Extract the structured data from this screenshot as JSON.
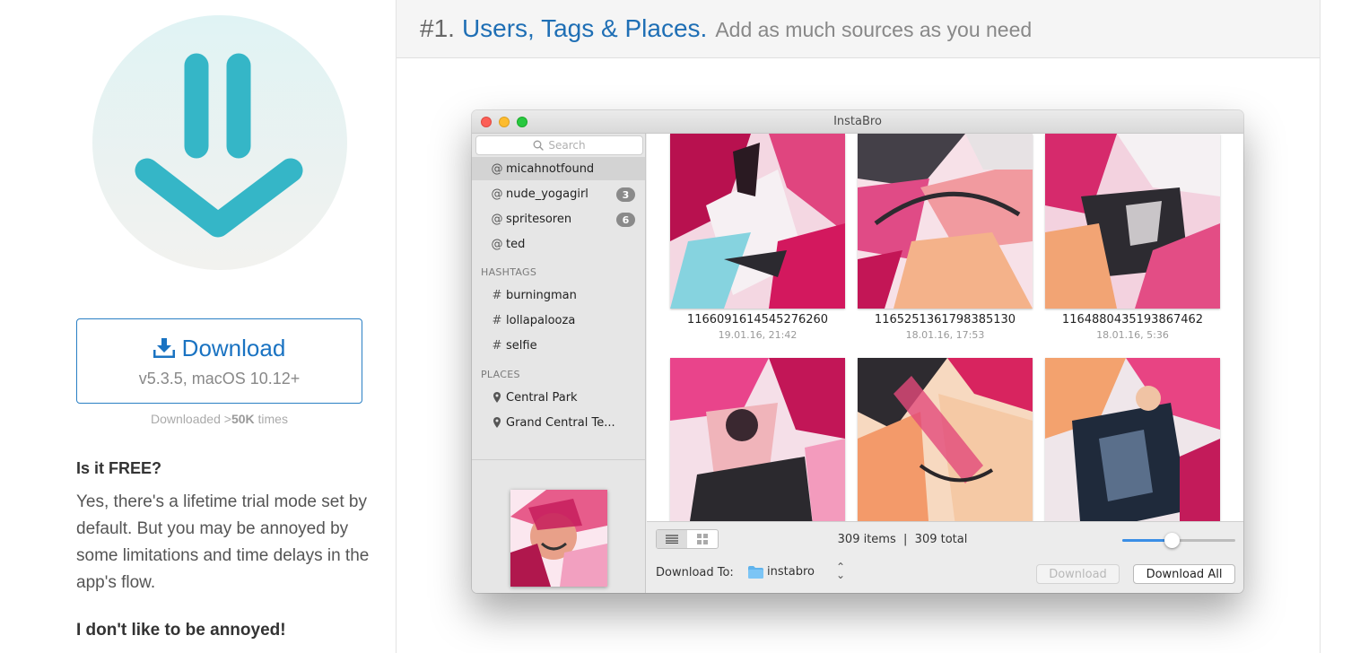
{
  "colors": {
    "brand_blue": "#1a73c2",
    "teal_logo": "#35b6c7",
    "selection_blue": "#3a8ee6"
  },
  "left": {
    "logo_icon": "download-arrow-icon",
    "download": {
      "label": "Download",
      "version": "v5.3.5, macOS 10.12+"
    },
    "downloaded": {
      "prefix": "Downloaded >",
      "count": "50K",
      "suffix": " times"
    },
    "faq": [
      {
        "q": "Is it FREE?",
        "a": "Yes, there's a lifetime trial mode set by default. But you may be annoyed by some limitations and time delays in the app's flow."
      },
      {
        "q": "I don't like to be annoyed!"
      }
    ]
  },
  "panel": {
    "num": "#1.",
    "title": "Users, Tags & Places.",
    "subtitle": "Add as much sources as you need"
  },
  "window": {
    "title": "InstaBro",
    "search_placeholder": "Search",
    "users": [
      {
        "prefix": "@",
        "name": "micahnotfound",
        "badge": null,
        "selected": true
      },
      {
        "prefix": "@",
        "name": "nude_yogagirl",
        "badge": "3"
      },
      {
        "prefix": "@",
        "name": "spritesoren",
        "badge": "6"
      },
      {
        "prefix": "@",
        "name": "ted",
        "badge": null
      }
    ],
    "hashtags_header": "HASHTAGS",
    "hashtags": [
      {
        "prefix": "#",
        "name": "burningman"
      },
      {
        "prefix": "#",
        "name": "lollapalooza"
      },
      {
        "prefix": "#",
        "name": "selfie"
      }
    ],
    "places_header": "PLACES",
    "places": [
      {
        "name": "Central Park"
      },
      {
        "name": "Grand Central Te..."
      }
    ],
    "photos": [
      {
        "id": "1166091614545276260",
        "date": "19.01.16, 21:42"
      },
      {
        "id": "1165251361798385130",
        "date": "18.01.16, 17:53"
      },
      {
        "id": "1164880435193867462",
        "date": "18.01.16, 5:36"
      },
      {
        "id": "",
        "date": ""
      },
      {
        "id": "",
        "date": ""
      },
      {
        "id": "",
        "date": ""
      }
    ],
    "status": {
      "items": "309 items",
      "sep": "|",
      "total": "309 total"
    },
    "thumbnail_size_slider": 0.44,
    "download_to_label": "Download To:",
    "folder": "instabro",
    "download_btn": "Download",
    "download_all_btn": "Download All"
  }
}
